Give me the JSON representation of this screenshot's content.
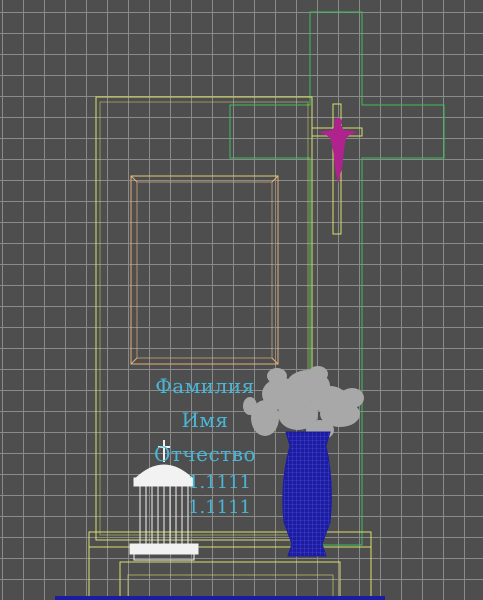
{
  "viewport": {
    "background": "#4e4e4e",
    "grid_color": "#8a8a8a"
  },
  "inscription": {
    "surname": "Фамилия",
    "name": "Имя",
    "patronymic": "Отчество",
    "birth_date": "1.1111",
    "death_date": "1.1111"
  },
  "colors": {
    "stele_wireframe": "#d8e06a",
    "cross_wireframe": "#3fbf5f",
    "frame_wireframe": "#e3b07a",
    "inscription": "#4ab6d6",
    "crucifix": "#b0238f",
    "vase": "#1c1ca3",
    "flowers": "#a8a8a8",
    "lantern": "#f2f2f2",
    "base_wireframe": "#d8e06a"
  },
  "icons": {
    "crucifix": "crucifix-icon",
    "lantern": "grave-lantern-icon",
    "vase": "vase-icon",
    "flowers": "flower-bouquet-icon"
  }
}
